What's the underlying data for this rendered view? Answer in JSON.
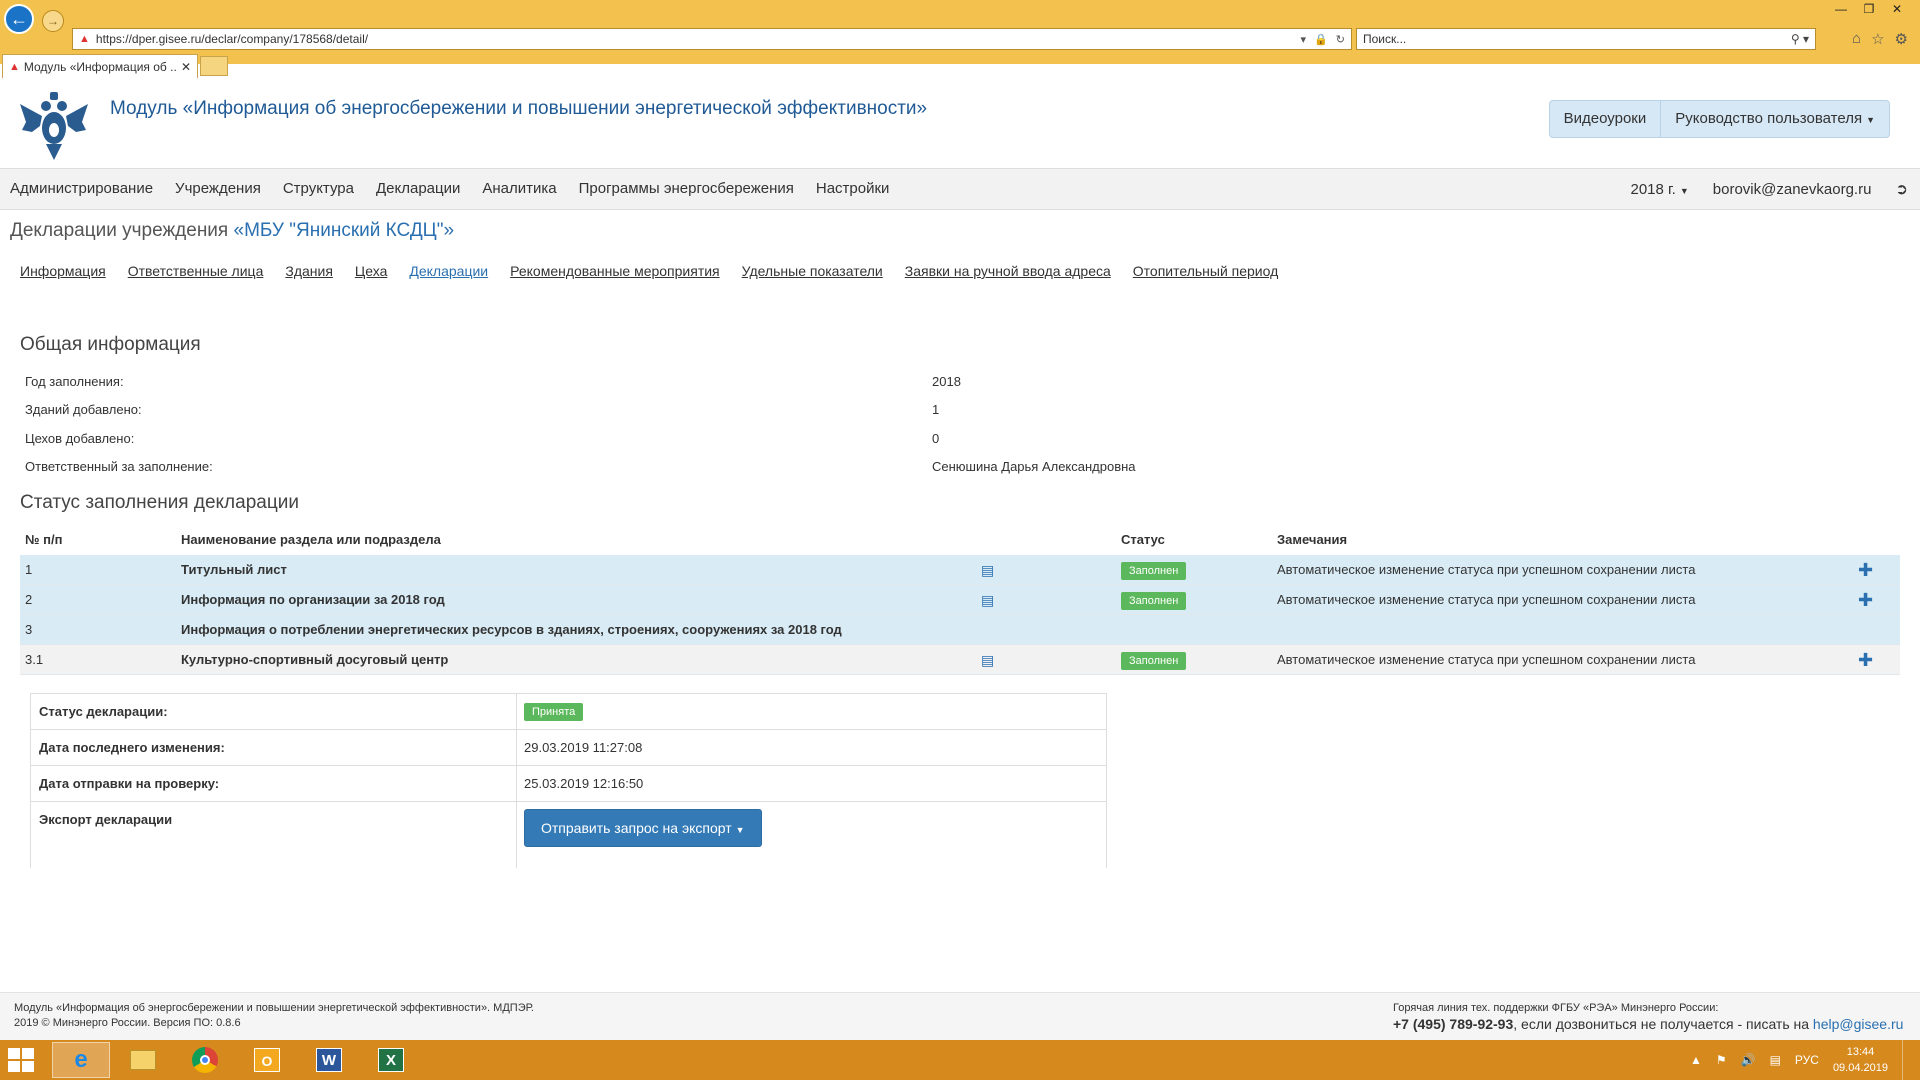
{
  "browser": {
    "url": "https://dper.gisee.ru/declar/company/178568/detail/",
    "search_placeholder": "Поиск...",
    "tab_title": "Модуль «Информация об ..."
  },
  "header": {
    "title": "Модуль «Информация об энергосбережении и повышении энергетической эффективности»",
    "btn_video": "Видеоуроки",
    "btn_guide": "Руководство пользователя"
  },
  "nav": {
    "items": [
      "Администрирование",
      "Учреждения",
      "Структура",
      "Декларации",
      "Аналитика",
      "Программы энергосбережения",
      "Настройки"
    ],
    "year": "2018 г.",
    "user": "borovik@zanevkaorg.ru"
  },
  "page": {
    "heading_prefix": "Декларации учреждения ",
    "org_name": "«МБУ \"Янинский КСДЦ\"»"
  },
  "subtabs": [
    "Информация",
    "Ответственные лица",
    "Здания",
    "Цеха",
    "Декларации",
    "Рекомендованные мероприятия",
    "Удельные показатели",
    "Заявки на ручной ввода адреса",
    "Отопительный период"
  ],
  "general": {
    "title": "Общая информация",
    "rows": [
      {
        "label": "Год заполнения:",
        "value": "2018"
      },
      {
        "label": "Зданий добавлено:",
        "value": "1"
      },
      {
        "label": "Цехов добавлено:",
        "value": "0"
      },
      {
        "label": "Ответственный за заполнение:",
        "value": "Сенюшина Дарья Александровна"
      }
    ]
  },
  "status": {
    "title": "Статус заполнения декларации",
    "headers": {
      "num": "№ п/п",
      "name": "Наименование раздела или подраздела",
      "status": "Статус",
      "notes": "Замечания"
    },
    "rows": [
      {
        "num": "1",
        "name": "Титульный лист",
        "status": "Заполнен",
        "note": "Автоматическое изменение статуса при успешном сохранении листа"
      },
      {
        "num": "2",
        "name": "Информация по организации за 2018 год",
        "status": "Заполнен",
        "note": "Автоматическое изменение статуса при успешном сохранении листа"
      },
      {
        "num": "3",
        "name": "Информация о потреблении энергетических ресурсов в зданиях, строениях, сооружениях за 2018 год",
        "status": "",
        "note": ""
      },
      {
        "num": "3.1",
        "name": "Культурно-спортивный досуговый центр",
        "status": "Заполнен",
        "note": "Автоматическое изменение статуса при успешном сохранении листа"
      }
    ],
    "status_color": "#5cb85c"
  },
  "declaration": {
    "status_label": "Статус декларации:",
    "status_value": "Принята",
    "modified_label": "Дата последнего изменения:",
    "modified_value": "29.03.2019 11:27:08",
    "sent_label": "Дата отправки на проверку:",
    "sent_value": "25.03.2019 12:16:50",
    "export_label": "Экспорт декларации",
    "export_button": "Отправить запрос на экспорт"
  },
  "footer": {
    "line1": "Модуль «Информация об энергосбережении и повышении энергетической эффективности». МДПЭР.",
    "line2": "2019 © Минэнерго России. Версия ПО: 0.8.6",
    "hotline": "Горячая линия тех. поддержки ФГБУ «РЭА» Минэнерго России:",
    "phone": "+7 (495) 789-92-93",
    "phone_suffix": ", если дозвониться не получается - писать на ",
    "email": "help@gisee.ru"
  },
  "taskbar": {
    "lang": "РУС",
    "time": "13:44",
    "date": "09.04.2019"
  }
}
